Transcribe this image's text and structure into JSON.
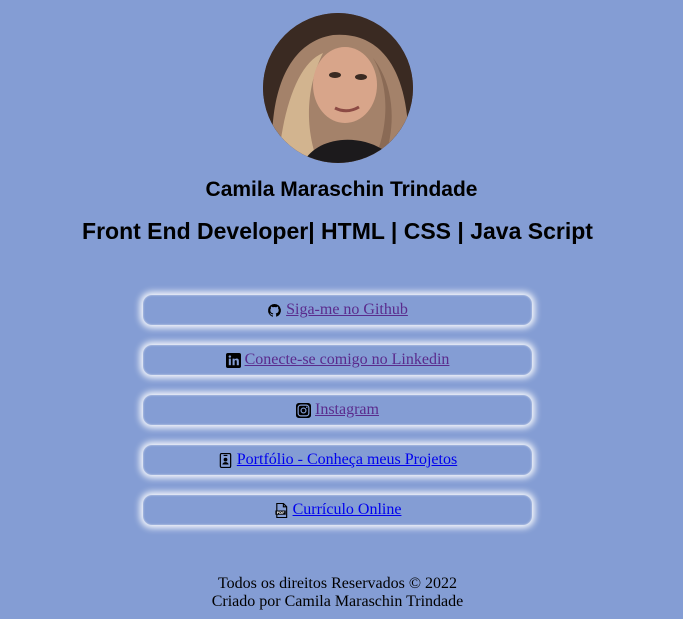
{
  "profile": {
    "name": "Camila Maraschin Trindade",
    "role": "Front End Developer| HTML | CSS | Java Script",
    "avatar_icon": "profile-photo"
  },
  "links": [
    {
      "label": "Siga-me no Github",
      "icon": "github-icon",
      "state": "visited"
    },
    {
      "label": "Conecte-se comigo no Linkedin",
      "icon": "linkedin-icon",
      "state": "visited"
    },
    {
      "label": "Instagram",
      "icon": "instagram-icon",
      "state": "visited"
    },
    {
      "label": "Portfólio - Conheça meus Projetos",
      "icon": "id-badge-icon",
      "state": "unvisited"
    },
    {
      "label": "Currículo Online",
      "icon": "pdf-file-icon",
      "state": "unvisited"
    }
  ],
  "footer": {
    "line1": "Todos os direitos Reservados © 2022",
    "line2": "Criado por Camila Maraschin Trindade"
  },
  "colors": {
    "background": "#849dd4",
    "visited_link": "#5a2b8d",
    "unvisited_link": "#0000ee",
    "card_glow": "#ffffff"
  }
}
